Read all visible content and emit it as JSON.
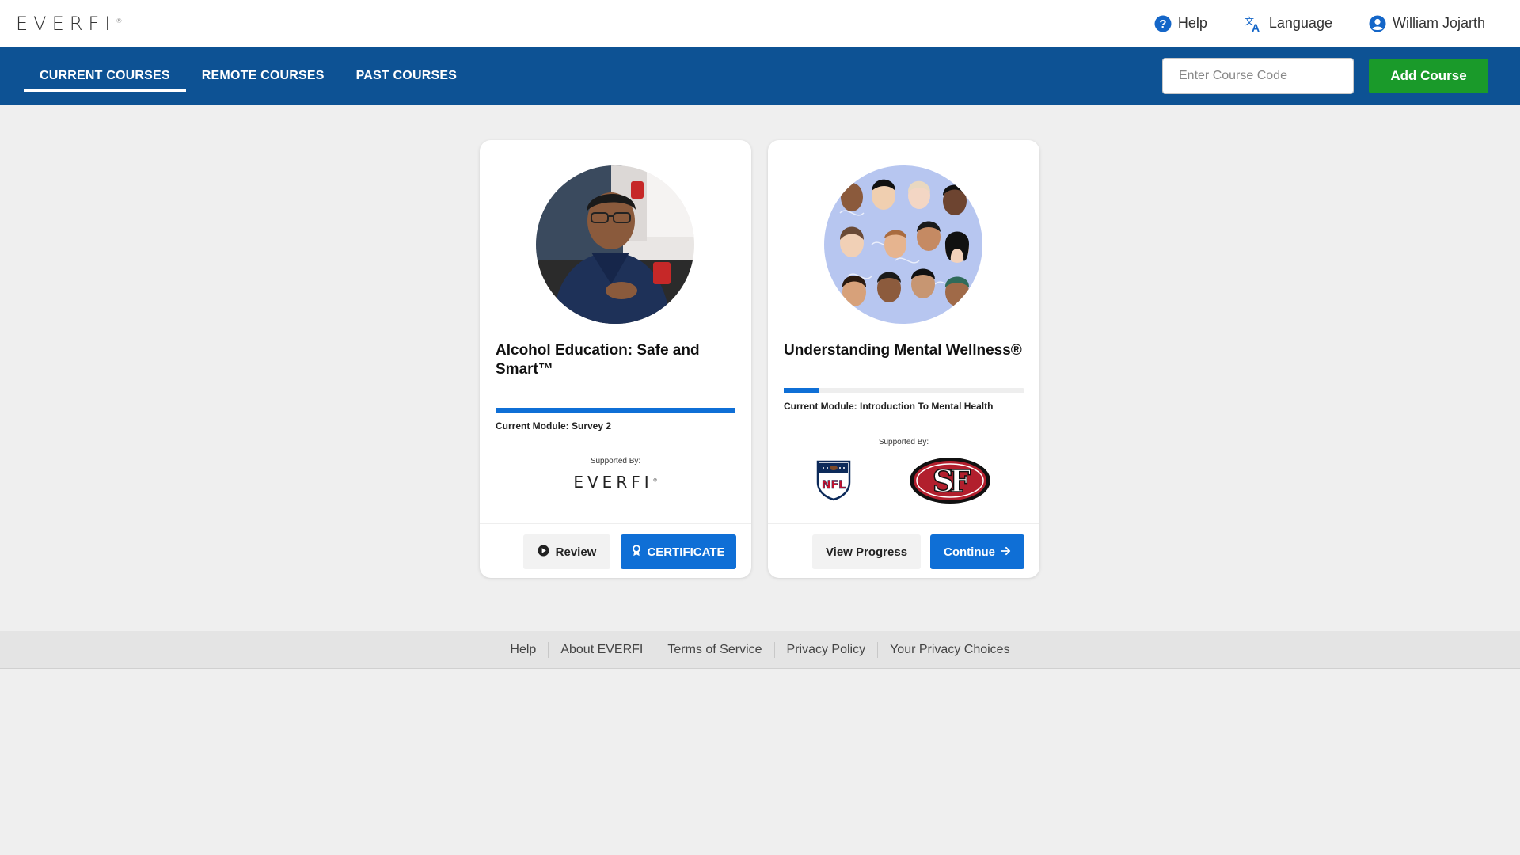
{
  "header": {
    "logo": "EVERFI",
    "logo_mark": "®",
    "help_label": "Help",
    "language_label": "Language",
    "user_name": "William Jojarth"
  },
  "nav": {
    "tabs": [
      {
        "label": "CURRENT COURSES",
        "active": true
      },
      {
        "label": "REMOTE COURSES",
        "active": false
      },
      {
        "label": "PAST COURSES",
        "active": false
      }
    ],
    "course_code_placeholder": "Enter Course Code",
    "add_course_label": "Add Course"
  },
  "courses": [
    {
      "title": "Alcohol Education: Safe and Smart™",
      "progress_fraction": 1.0,
      "current_module": "Current Module: Survey 2",
      "supported_by_label": "Supported By:",
      "sponsor": "EVERFI",
      "sponsor_mark": "®",
      "secondary_button": "Review",
      "primary_button": "CERTIFICATE"
    },
    {
      "title": "Understanding Mental Wellness®",
      "progress_fraction": 0.15,
      "current_module": "Current Module: Introduction To Mental Health",
      "supported_by_label": "Supported By:",
      "sponsor_logos": [
        "NFL",
        "SF"
      ],
      "secondary_button": "View Progress",
      "primary_button": "Continue"
    }
  ],
  "footer": {
    "links": [
      "Help",
      "About EVERFI",
      "Terms of Service",
      "Privacy Policy",
      "Your Privacy Choices"
    ]
  },
  "colors": {
    "nav_bg": "#0d5294",
    "primary_blue": "#0f6fd6",
    "add_green": "#1a9a2a"
  }
}
